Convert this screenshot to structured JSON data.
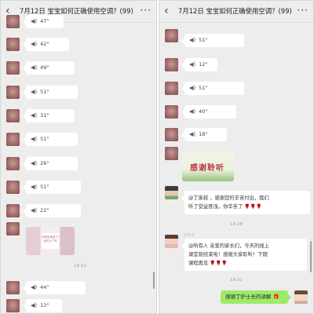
{
  "chat_title": "7月12日  宝宝如何正确使用空调？(99)",
  "icons": {
    "back": "chevron-left-icon",
    "more": "more-icon",
    "voice": "voice-wave-icon"
  },
  "left_panel": {
    "voice_messages_top": [
      "47\"",
      "42\"",
      "49\"",
      "51\"",
      "31\"",
      "51\"",
      "26\"",
      "51\"",
      "22\""
    ],
    "image_text": "你相信宝宝\n已经长大了吗",
    "time": "14:11",
    "voice_messages_bottom": [
      "44\"",
      "13\""
    ]
  },
  "right_panel": {
    "voice_messages": [
      "51\"",
      "12\"",
      "51\"",
      "40\"",
      "18\""
    ],
    "sticker_text": "感谢聆听",
    "msg1_line1": "@丁家叔 ，感谢您的辛苦付出，我们",
    "msg1_line2": "听了受益匪浅，你辛苦了",
    "time1": "14:28",
    "nick2": "小叶子",
    "msg2_line1": "@所有人  亲爱的家长们，今天的线上",
    "msg2_line2": "课堂就结束啦！感谢大家聆听！下期",
    "msg2_line3": "课程再见",
    "time2": "14:31",
    "my_message": "感谢丁护士长的讲解",
    "flowers": "🌹🌹🌹"
  },
  "colors": {
    "chat_bg": "#ededed",
    "bubble": "#ffffff",
    "my_bubble": "#9eea6a"
  }
}
